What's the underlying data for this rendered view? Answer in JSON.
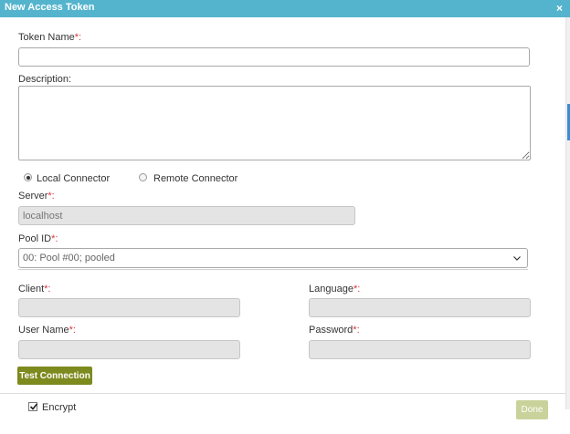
{
  "dialog": {
    "title": "New Access Token",
    "close_glyph": "×"
  },
  "form": {
    "token_name": {
      "label": "Token Name",
      "required_mark": "*:",
      "value": ""
    },
    "description": {
      "label": "Description:",
      "value": ""
    },
    "connector": {
      "options": [
        "Local Connector",
        "Remote Connector"
      ],
      "selected": "Local Connector"
    },
    "server": {
      "label": "Server",
      "required_mark": "*:",
      "value": "localhost"
    },
    "pool_id": {
      "label": "Pool ID",
      "required_mark": "*:",
      "value": "00: Pool #00; pooled"
    },
    "client": {
      "label": "Client",
      "required_mark": "*:",
      "value": ""
    },
    "language": {
      "label": "Language",
      "required_mark": "*:",
      "value": ""
    },
    "user_name": {
      "label": "User Name",
      "required_mark": "*:",
      "value": ""
    },
    "password": {
      "label": "Password",
      "required_mark": "*:",
      "value": ""
    },
    "test_button": "Test Connection"
  },
  "footer": {
    "encrypt": {
      "label": "Encrypt",
      "checked": true
    },
    "done_button": "Done"
  },
  "colors": {
    "title_bar": "#55b4cd",
    "test_button": "#7d8a1e",
    "done_button_disabled": "#c9d29a",
    "required": "#d9363e"
  },
  "icons": {
    "close": "close-icon",
    "dropdown": "chevron-down-icon",
    "resize": "resize-grip-icon",
    "check": "checkmark-icon"
  }
}
